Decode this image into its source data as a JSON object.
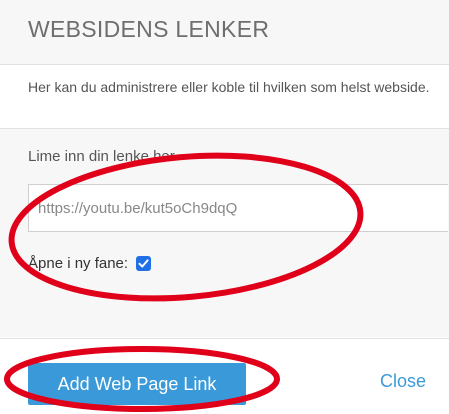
{
  "header": {
    "title": "WEBSIDENS LENKER"
  },
  "description": "Her kan du administrere eller koble til hvilken som helst webside.",
  "link_field": {
    "label": "Lime inn din lenke her",
    "value": "https://youtu.be/kut5oCh9dqQ"
  },
  "new_tab": {
    "label": "Åpne i ny fane:",
    "checked": true
  },
  "footer": {
    "add_label": "Add Web Page Link",
    "close_label": "Close"
  },
  "colors": {
    "accent": "#3a9ad9",
    "checkbox": "#1f6fe5",
    "annotation": "#e0001a",
    "header_bg": "#f7f7f7"
  },
  "annotations": {
    "style": "red ellipse",
    "targets": [
      "link-input-and-new-tab-option",
      "add-web-page-link-button"
    ]
  }
}
